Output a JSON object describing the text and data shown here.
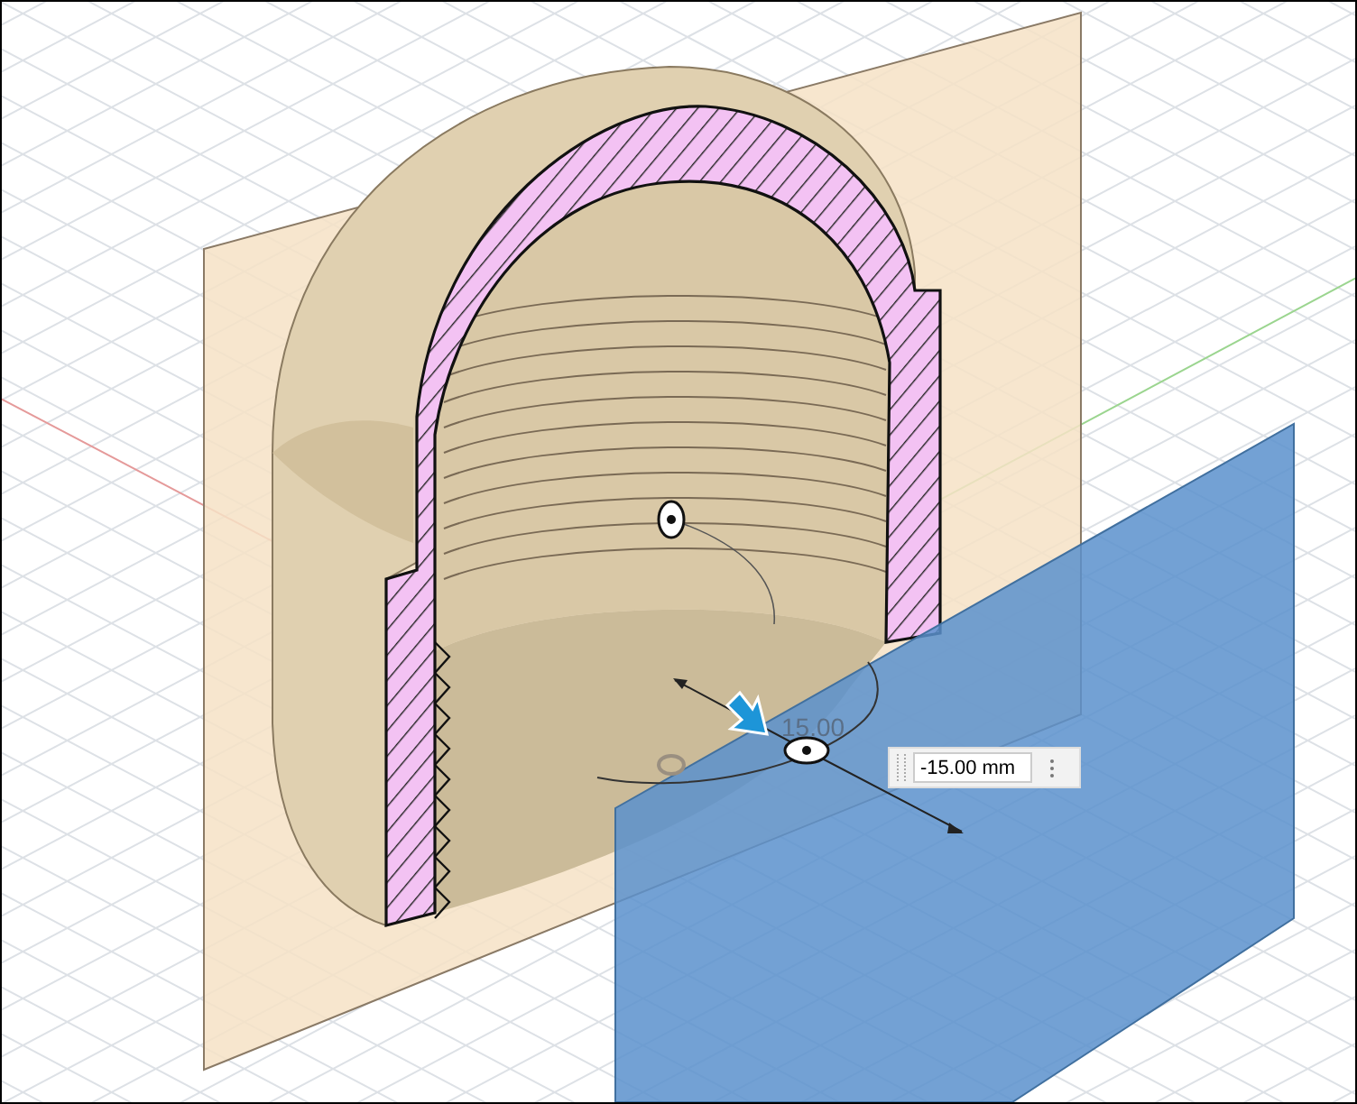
{
  "viewport": {
    "angle_label": "15.00",
    "input": {
      "value": "-15.00 mm"
    }
  }
}
